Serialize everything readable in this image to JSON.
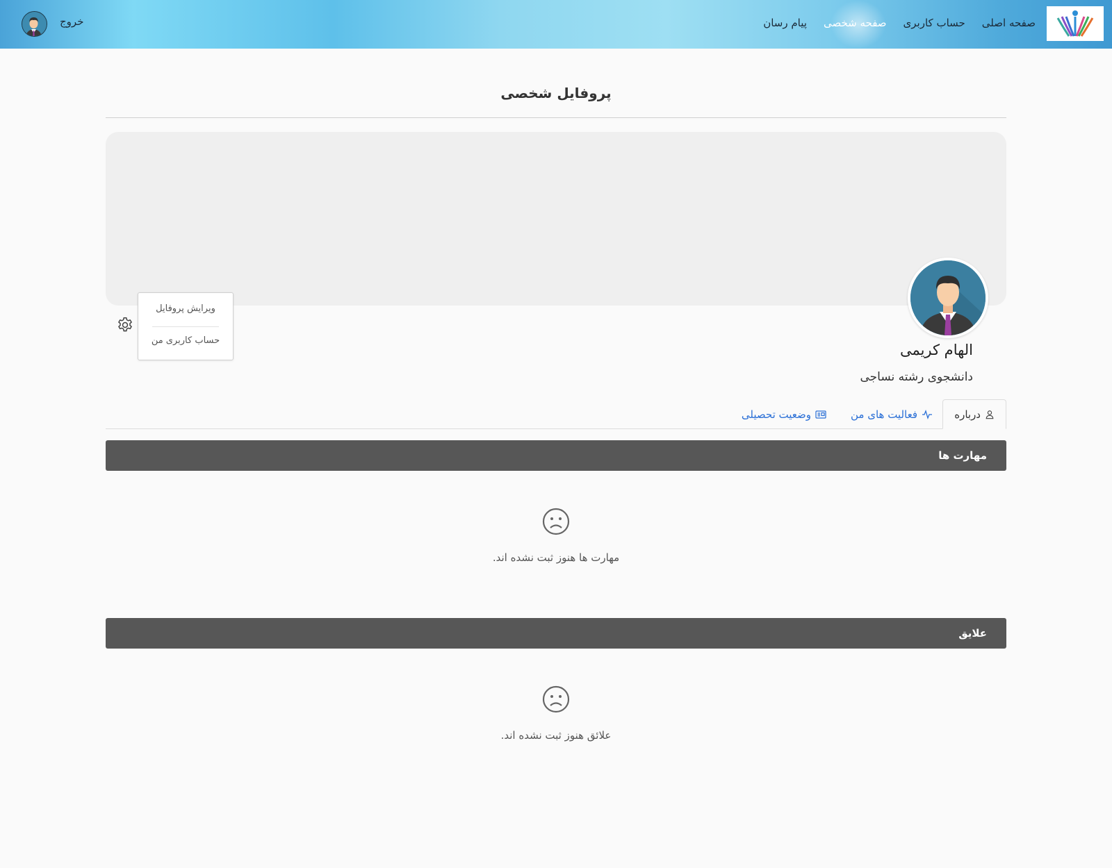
{
  "navbar": {
    "links": [
      {
        "label": "صفحه اصلی"
      },
      {
        "label": "حساب کاربری"
      },
      {
        "label": "صفحه شخصی"
      },
      {
        "label": "پیام رسان"
      }
    ],
    "logout_label": "خروج"
  },
  "page": {
    "title": "پروفایل شخصی"
  },
  "profile": {
    "name": "الهام کریمی",
    "subtitle": "دانشجوی رشته نساجی"
  },
  "settings_menu": {
    "items": [
      {
        "label": "ویرایش پروفایل"
      },
      {
        "label": "حساب کاربری من"
      }
    ]
  },
  "tabs": [
    {
      "label": "درباره",
      "icon": "user-icon"
    },
    {
      "label": "فعالیت های من",
      "icon": "activity-icon"
    },
    {
      "label": "وضعیت تحصیلی",
      "icon": "id-card-icon"
    }
  ],
  "sections": {
    "skills": {
      "title": "مهارت ها",
      "empty_text": "مهارت ها هنوز ثبت نشده اند."
    },
    "interests": {
      "title": "علایق",
      "empty_text": "علائق هنوز ثبت نشده اند."
    }
  },
  "colors": {
    "link": "#2a6fd6",
    "section_bar": "#575757",
    "cover": "#efefef"
  }
}
